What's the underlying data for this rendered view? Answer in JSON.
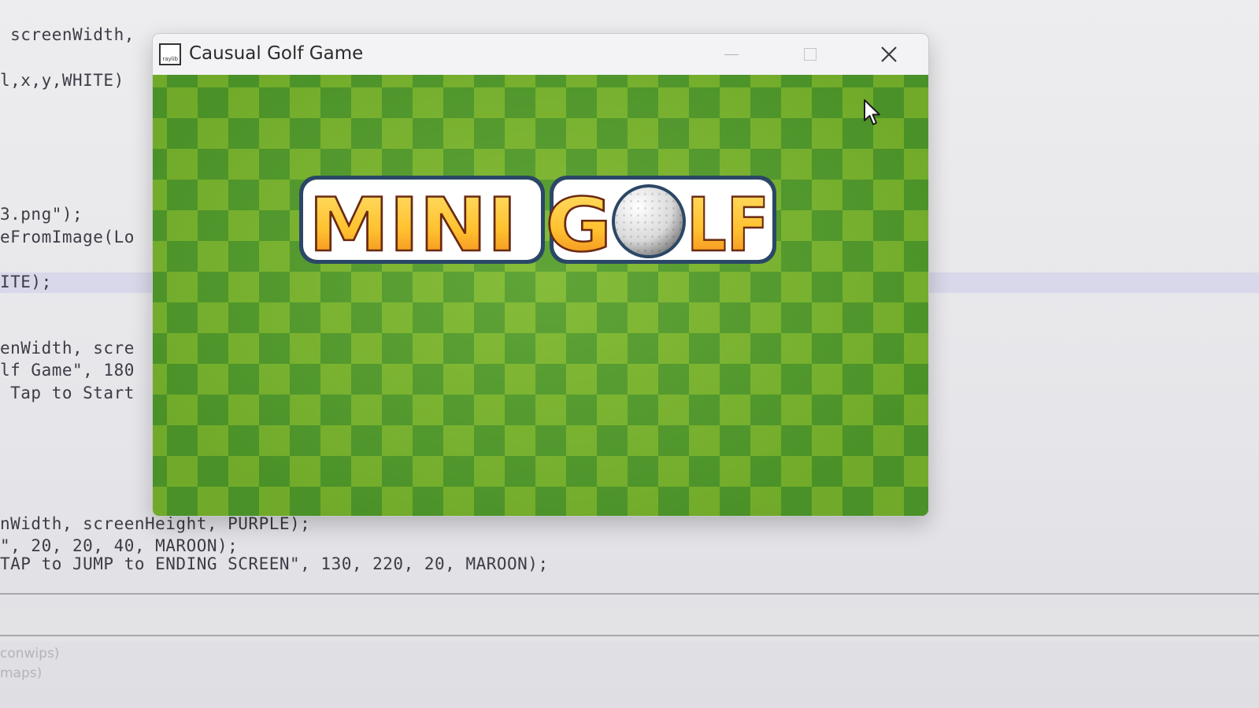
{
  "editor": {
    "code_lines": [
      " screenWidth, ",
      "l,x,y,WHITE)",
      "3.png\");",
      "eFromImage(Lo",
      "ITE);",
      "enWidth, scre",
      "lf Game\", 180",
      " Tap to Start",
      "nWidth, screenHeight, PURPLE);",
      "\", 20, 20, 40, MAROON);",
      "TAP to JUMP to ENDING SCREEN\", 130, 220, 20, MAROON);"
    ],
    "output_lines": [
      "conwips)",
      "maps)"
    ]
  },
  "window": {
    "title": "Causual Golf Game",
    "icon_text": "raylib",
    "controls": {
      "minimize": "minimize",
      "maximize": "maximize",
      "close": "close"
    }
  },
  "game": {
    "logo_text_left": "MINI G",
    "logo_text_right": "LF",
    "checker_colors": {
      "light": "#78b52c",
      "dark": "#4e9a2a"
    },
    "logo_colors": {
      "fill_top": "#ffd54a",
      "fill_bottom": "#f08c1e",
      "outline": "#2f4a6b",
      "inner_outline": "#ffffff"
    }
  }
}
